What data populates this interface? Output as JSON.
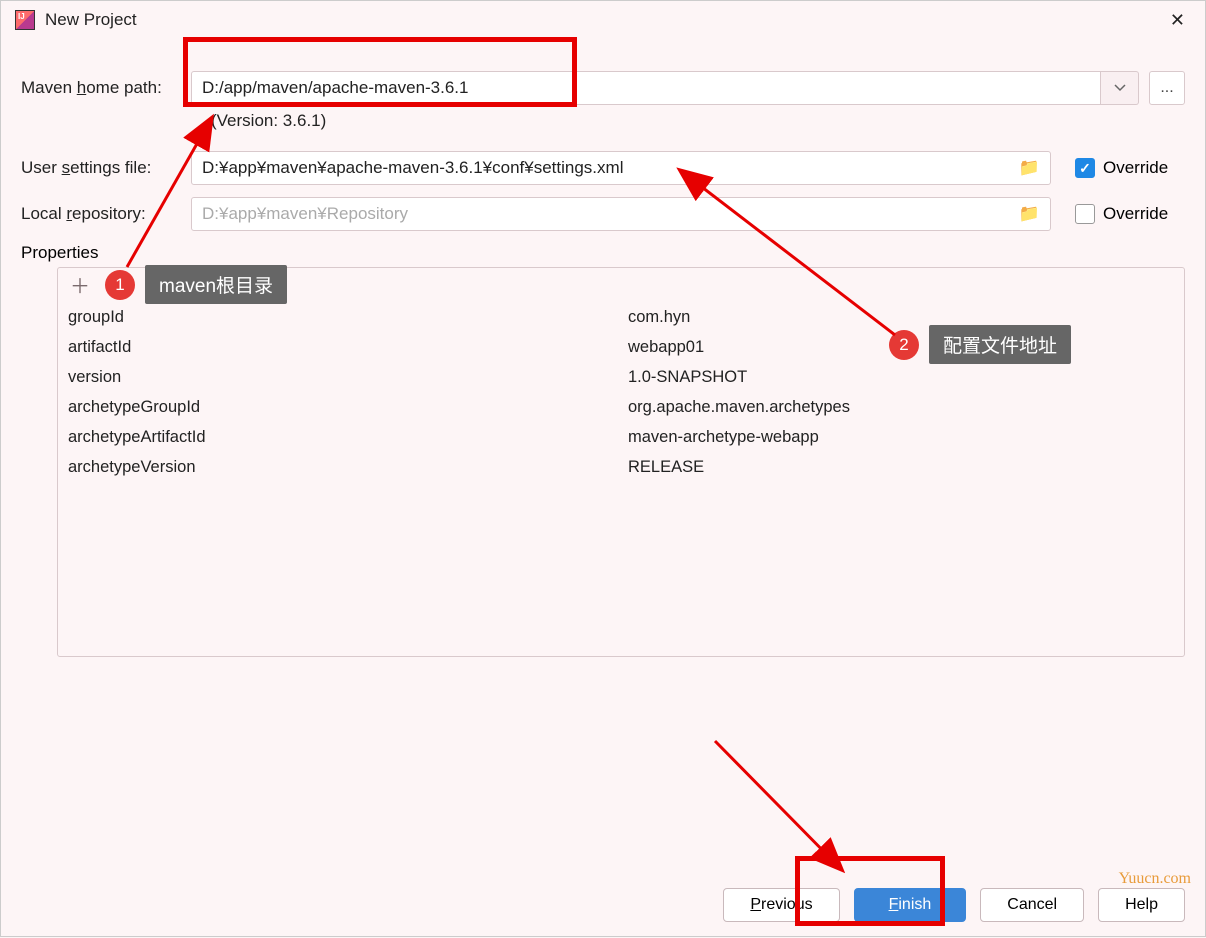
{
  "title": "New Project",
  "labels": {
    "mavenHome_pre": "Maven ",
    "mavenHome_u": "h",
    "mavenHome_post": "ome path:",
    "userSettings_pre": "User ",
    "userSettings_u": "s",
    "userSettings_post": "ettings file:",
    "localRepo_pre": "Local ",
    "localRepo_u": "r",
    "localRepo_post": "epository:",
    "properties": "Properties",
    "override": "Override",
    "version_text": "(Version: 3.6.1)"
  },
  "fields": {
    "maven_home": "D:/app/maven/apache-maven-3.6.1",
    "user_settings": "D:¥app¥maven¥apache-maven-3.6.1¥conf¥settings.xml",
    "local_repo": "D:¥app¥maven¥Repository",
    "more": "..."
  },
  "override": {
    "settings": true,
    "repo": false
  },
  "properties_rows": [
    {
      "key": "groupId",
      "value": "com.hyn"
    },
    {
      "key": "artifactId",
      "value": "webapp01"
    },
    {
      "key": "version",
      "value": "1.0-SNAPSHOT"
    },
    {
      "key": "archetypeGroupId",
      "value": "org.apache.maven.archetypes"
    },
    {
      "key": "archetypeArtifactId",
      "value": "maven-archetype-webapp"
    },
    {
      "key": "archetypeVersion",
      "value": "RELEASE"
    }
  ],
  "buttons": {
    "previous_u": "P",
    "previous_rest": "revious",
    "finish_u": "F",
    "finish_rest": "inish",
    "cancel": "Cancel",
    "help": "Help"
  },
  "annotations": {
    "callout1_num": "1",
    "callout1_label": "maven根目录",
    "callout2_num": "2",
    "callout2_label": "配置文件地址"
  },
  "watermark": "Yuucn.com"
}
